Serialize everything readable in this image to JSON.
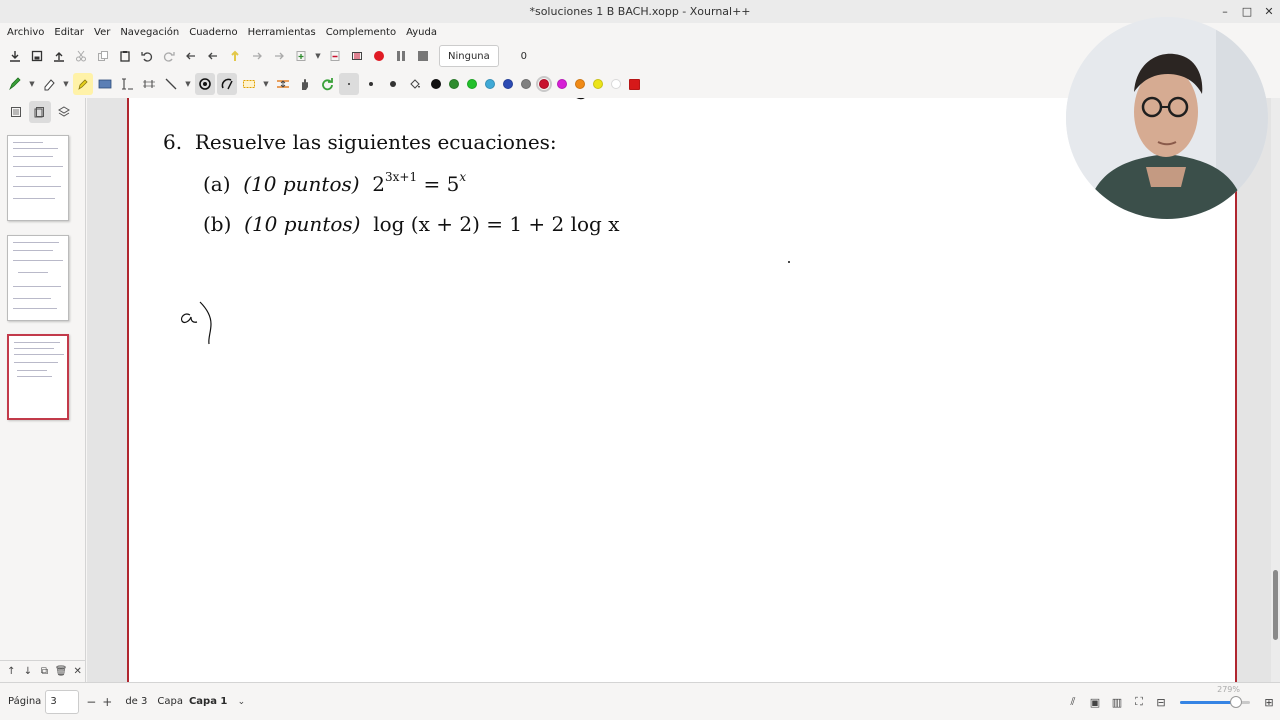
{
  "window": {
    "title": "*soluciones 1 B BACH.xopp - Xournal++",
    "controls": [
      "–",
      "□",
      "✕"
    ]
  },
  "menu": [
    "Archivo",
    "Editar",
    "Ver",
    "Navegación",
    "Cuaderno",
    "Herramientas",
    "Complemento",
    "Ayuda"
  ],
  "toolbar": {
    "layer_select": "Ninguna",
    "count": "0",
    "colors": [
      "#111111",
      "#2e8b2e",
      "#22c02a",
      "#3fa9d6",
      "#2c4bb3",
      "#808080",
      "#c8102e",
      "#d61fd6",
      "#f08a16",
      "#ece419",
      "#ffffff",
      "#d61919"
    ],
    "selected_color": "#c8102e"
  },
  "document": {
    "q_number": "6.",
    "q_text": "Resuelve las siguientes ecuaciones:",
    "a_label": "(a)",
    "a_points": "(10 puntos)",
    "a_base": "2",
    "a_exp": "3x+1",
    "a_eq": " = 5",
    "a_exp2": "x",
    "b_label": "(b)",
    "b_points": "(10 puntos)",
    "b_eq": "log (x + 2) = 1 + 2 log x"
  },
  "status": {
    "page_label": "Página",
    "page_value": "3",
    "of_pages": "de 3",
    "layer_label": "Capa",
    "layer_value": "Capa 1",
    "zoom": "279%",
    "zoom_fraction": 0.8
  }
}
